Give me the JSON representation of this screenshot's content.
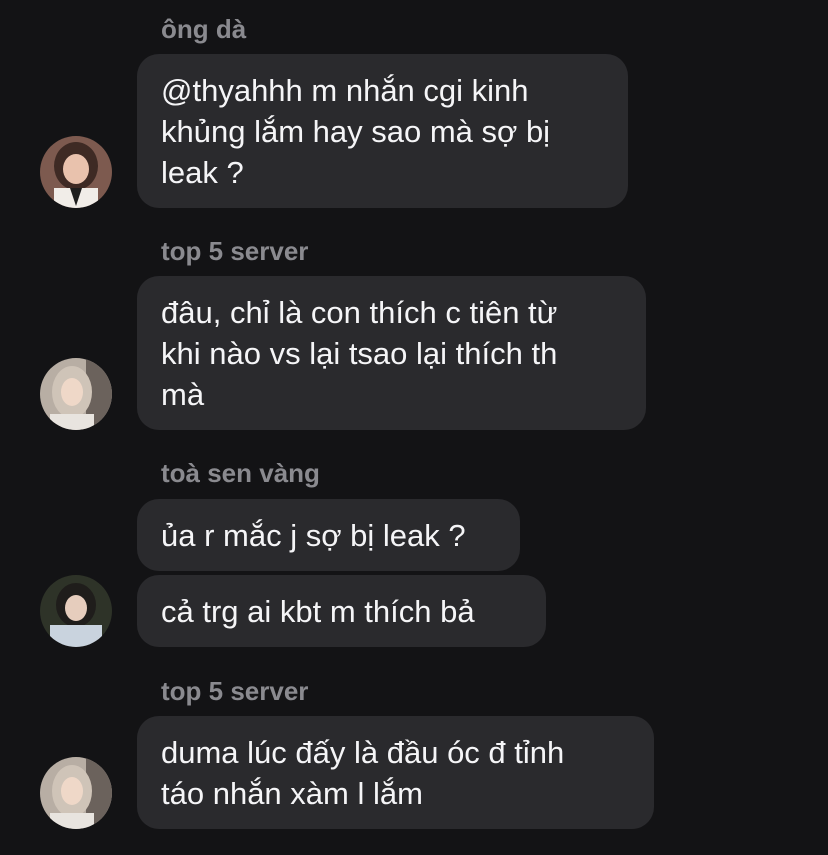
{
  "messages": [
    {
      "sender": "ông dà",
      "bubbles": [
        "@thyahhh m nhắn cgi kinh\nkhủng lắm hay sao mà sợ bị\nleak ?"
      ]
    },
    {
      "sender": "top 5 server",
      "bubbles": [
        "đâu, chỉ là con thích c tiên từ\nkhi nào vs lại tsao lại thích th\nmà"
      ]
    },
    {
      "sender": "toà sen vàng",
      "bubbles": [
        "ủa r mắc j sợ bị leak ?",
        "cả trg ai kbt m thích bả"
      ]
    },
    {
      "sender": "top 5 server",
      "bubbles": [
        "duma lúc đấy là đầu óc đ tỉnh\ntáo nhắn xàm l lắm"
      ]
    }
  ],
  "colors": {
    "background": "#131315",
    "bubble": "#2a2a2d",
    "sender_name": "#8a8a8f",
    "message_text": "#f5f5f7"
  }
}
